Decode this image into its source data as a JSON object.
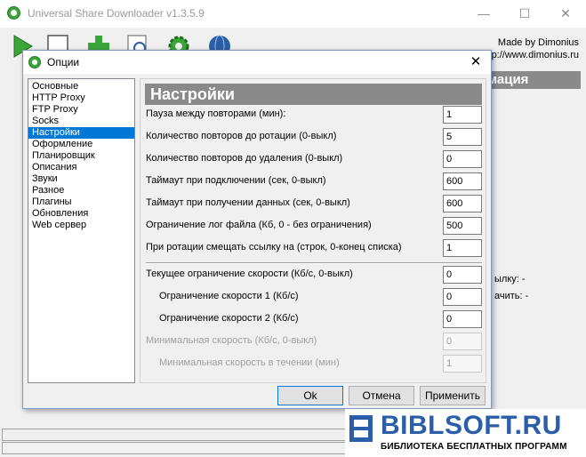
{
  "app": {
    "title": "Universal Share Downloader v1.3.5.9",
    "made_by": "Made by Dimonius",
    "site": "p://www.dimonius.ru",
    "right_panel_head": "мация",
    "right_line_1": "ылку: -",
    "right_line_2": "ачить: -",
    "window_controls": {
      "minimize": "—",
      "maximize": "☐",
      "close": "✕"
    },
    "toolbar_icons": [
      "play-icon",
      "new-page-icon",
      "add-icon",
      "search-page-icon",
      "settings-gear-icon",
      "globe-icon"
    ]
  },
  "dialog": {
    "title": "Опции",
    "close": "✕",
    "categories": [
      {
        "label": "Основные",
        "selected": false
      },
      {
        "label": "HTTP Proxy",
        "selected": false
      },
      {
        "label": "FTP Proxy",
        "selected": false
      },
      {
        "label": "Socks",
        "selected": false
      },
      {
        "label": "Настройки",
        "selected": true
      },
      {
        "label": "Оформление",
        "selected": false
      },
      {
        "label": "Планировщик",
        "selected": false
      },
      {
        "label": "Описания",
        "selected": false
      },
      {
        "label": "Звуки",
        "selected": false
      },
      {
        "label": "Разное",
        "selected": false
      },
      {
        "label": "Плагины",
        "selected": false
      },
      {
        "label": "Обновления",
        "selected": false
      },
      {
        "label": "Web сервер",
        "selected": false
      }
    ],
    "panel_title": "Настройки",
    "settings": [
      {
        "label": "Пауза между повторами (мин):",
        "value": "1",
        "indent": false,
        "disabled": false
      },
      {
        "label": "Количество повторов до ротации (0-выкл)",
        "value": "5",
        "indent": false,
        "disabled": false
      },
      {
        "label": "Количество повторов до удаления (0-выкл)",
        "value": "0",
        "indent": false,
        "disabled": false
      },
      {
        "label": "Таймаут при подключении (сек, 0-выкл)",
        "value": "600",
        "indent": false,
        "disabled": false
      },
      {
        "label": "Таймаут при получении данных (сек, 0-выкл)",
        "value": "600",
        "indent": false,
        "disabled": false
      },
      {
        "label": "Ограничение лог файла (Кб, 0 - без ограничения)",
        "value": "500",
        "indent": false,
        "disabled": false
      },
      {
        "label": "При ротации смещать ссылку на (строк, 0-конец списка)",
        "value": "1",
        "indent": false,
        "disabled": false
      },
      {
        "label": "Текущее ограничение скорости (Кб/с, 0-выкл)",
        "value": "0",
        "indent": false,
        "disabled": false
      },
      {
        "label": "Ограничение скорости 1 (Кб/с)",
        "value": "0",
        "indent": true,
        "disabled": false
      },
      {
        "label": "Ограничение скорости 2 (Кб/с)",
        "value": "0",
        "indent": true,
        "disabled": false
      },
      {
        "label": "Минимальная  скорость (Кб/с, 0-выкл)",
        "value": "0",
        "indent": false,
        "disabled": true
      },
      {
        "label": "Минимальная скорость в течении (мин)",
        "value": "1",
        "indent": true,
        "disabled": true
      }
    ],
    "buttons": {
      "ok": "Ok",
      "cancel": "Отмена",
      "apply": "Применить"
    }
  },
  "watermark": {
    "title": "BIBLSOFT.RU",
    "subtitle": "БИБЛИОТЕКА БЕСПЛАТНЫХ ПРОГРАММ",
    "brand_color": "#2a5ea8"
  }
}
